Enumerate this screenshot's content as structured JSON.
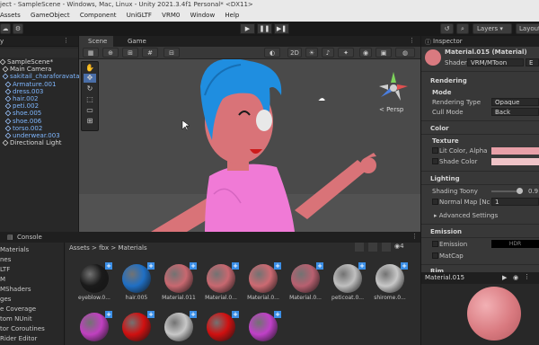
{
  "window": {
    "title": "ject - SampleScene - Windows, Mac, Linux - Unity 2021.3.4f1 Personal* <DX11>"
  },
  "menu": [
    "Assets",
    "GameObject",
    "Component",
    "UniGLTF",
    "VRM0",
    "Window",
    "Help"
  ],
  "toolbar": {
    "play_icon": "▶",
    "pause_icon": "❚❚",
    "step_icon": "▶❚",
    "layers_label": "Layers",
    "layout_label": "Layout"
  },
  "hierarchy": {
    "tab": "y",
    "items": [
      {
        "label": "SampleScene*",
        "indent": 0,
        "color": "white"
      },
      {
        "label": "Main Camera",
        "indent": 1,
        "color": "white"
      },
      {
        "label": "sakitail_charaforavatar_wi",
        "indent": 1,
        "color": "blue"
      },
      {
        "label": "Armature.001",
        "indent": 2,
        "color": "blue"
      },
      {
        "label": "dress.003",
        "indent": 2,
        "color": "blue"
      },
      {
        "label": "hair.002",
        "indent": 2,
        "color": "blue"
      },
      {
        "label": "peti.002",
        "indent": 2,
        "color": "blue"
      },
      {
        "label": "shoe.005",
        "indent": 2,
        "color": "blue"
      },
      {
        "label": "shoe.006",
        "indent": 2,
        "color": "blue"
      },
      {
        "label": "torso.002",
        "indent": 2,
        "color": "blue"
      },
      {
        "label": "underwear.003",
        "indent": 2,
        "color": "blue"
      },
      {
        "label": "Directional Light",
        "indent": 1,
        "color": "white"
      }
    ]
  },
  "scene": {
    "tabs": [
      "Scene",
      "Game"
    ],
    "mode_2d": "2D",
    "persp_label": "< Persp",
    "gizmo_axes": [
      "y",
      "x",
      "z"
    ]
  },
  "inspector": {
    "tab": "Inspector",
    "material_name": "Material.015 (Material)",
    "shader_label": "Shader",
    "shader_value": "VRM/MToon",
    "edit_label": "E",
    "sections": {
      "rendering": "Rendering",
      "mode": "Mode",
      "rendering_type_label": "Rendering Type",
      "rendering_type_value": "Opaque",
      "cull_mode_label": "Cull Mode",
      "cull_mode_value": "Back",
      "color": "Color",
      "texture": "Texture",
      "lit_color_label": "Lit Color, Alpha",
      "shade_color_label": "Shade Color",
      "lighting": "Lighting",
      "shading_toony_label": "Shading Toony",
      "shading_toony_value": "0.9",
      "normal_map_label": "Normal Map [Nc",
      "normal_map_value": "1",
      "advanced": "Advanced Settings",
      "emission": "Emission",
      "emission_label": "Emission",
      "hdr_label": "HDR",
      "matcap_label": "MatCap",
      "rim": "Rim"
    },
    "lit_color": "#e8a0a8",
    "shade_color": "#f0c4c8"
  },
  "preview": {
    "title": "Material.015",
    "ball_color": "#d97a80"
  },
  "bottom": {
    "tab": "Console",
    "breadcrumb": [
      "Assets",
      "fbx",
      "Materials"
    ],
    "count": "4",
    "left_items": [
      "Materials",
      "nes",
      "LTF",
      "M",
      "MShaders",
      "ges",
      "e Coverage",
      "tom NUnit",
      "tor Coroutines",
      "Rider Editor"
    ],
    "assets_row1": [
      {
        "name": "eyeblow.0...",
        "color": "#1a1a1a"
      },
      {
        "name": "hair.005",
        "color": "#1f6fc4"
      },
      {
        "name": "Material.011",
        "color": "#c86870"
      },
      {
        "name": "Material.0...",
        "color": "#c86870"
      },
      {
        "name": "Material.0...",
        "color": "#cc6a72"
      },
      {
        "name": "Material.0...",
        "color": "#b86070"
      },
      {
        "name": "peticoat.0...",
        "color": "#c0c0c0"
      },
      {
        "name": "shirome.0...",
        "color": "#c8c8c8"
      }
    ],
    "assets_row2": [
      {
        "name": "",
        "color": "#c040c0"
      },
      {
        "name": "",
        "color": "#d01010"
      },
      {
        "name": "",
        "color": "#c8c8c8"
      },
      {
        "name": "",
        "color": "#d01010"
      },
      {
        "name": "",
        "color": "#c040c8"
      }
    ]
  }
}
